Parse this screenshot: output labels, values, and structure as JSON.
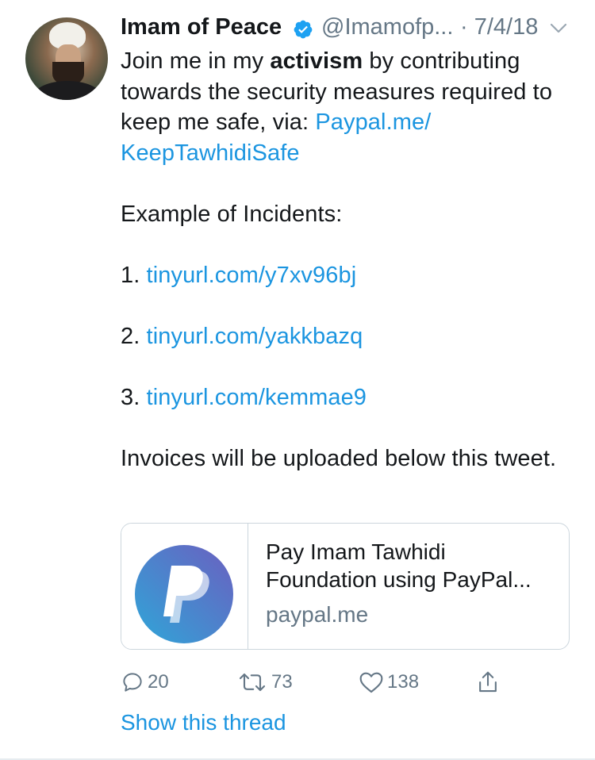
{
  "author": {
    "name": "Imam of Peace",
    "handle": "@Imamofp...",
    "date": "· 7/4/18",
    "verified_icon": "verified-badge-icon"
  },
  "tweet": {
    "line1_pre": "Join me in my ",
    "line1_bold": "activism",
    "line1_post": " by contributing towards the security measures required to keep me safe, via: ",
    "donate_link_1": "Paypal.me/",
    "donate_link_2": "KeepTawhidiSafe",
    "incidents_heading": "Example of Incidents:",
    "incidents": [
      {
        "num": "1. ",
        "link": "tinyurl.com/y7xv96bj"
      },
      {
        "num": "2. ",
        "link": "tinyurl.com/yakkbazq"
      },
      {
        "num": "3. ",
        "link": "tinyurl.com/kemmae9"
      }
    ],
    "closing": "Invoices will be uploaded below this tweet."
  },
  "card": {
    "title": "Pay Imam Tawhidi Foundation using PayPal...",
    "domain": "paypal.me",
    "logo_icon": "paypal-logo-icon"
  },
  "actions": {
    "replies": "20",
    "retweets": "73",
    "likes": "138"
  },
  "show_thread": "Show this thread",
  "colors": {
    "link": "#1b95e0",
    "text": "#14171a",
    "secondary": "#657786",
    "border": "#ccd6dd"
  }
}
